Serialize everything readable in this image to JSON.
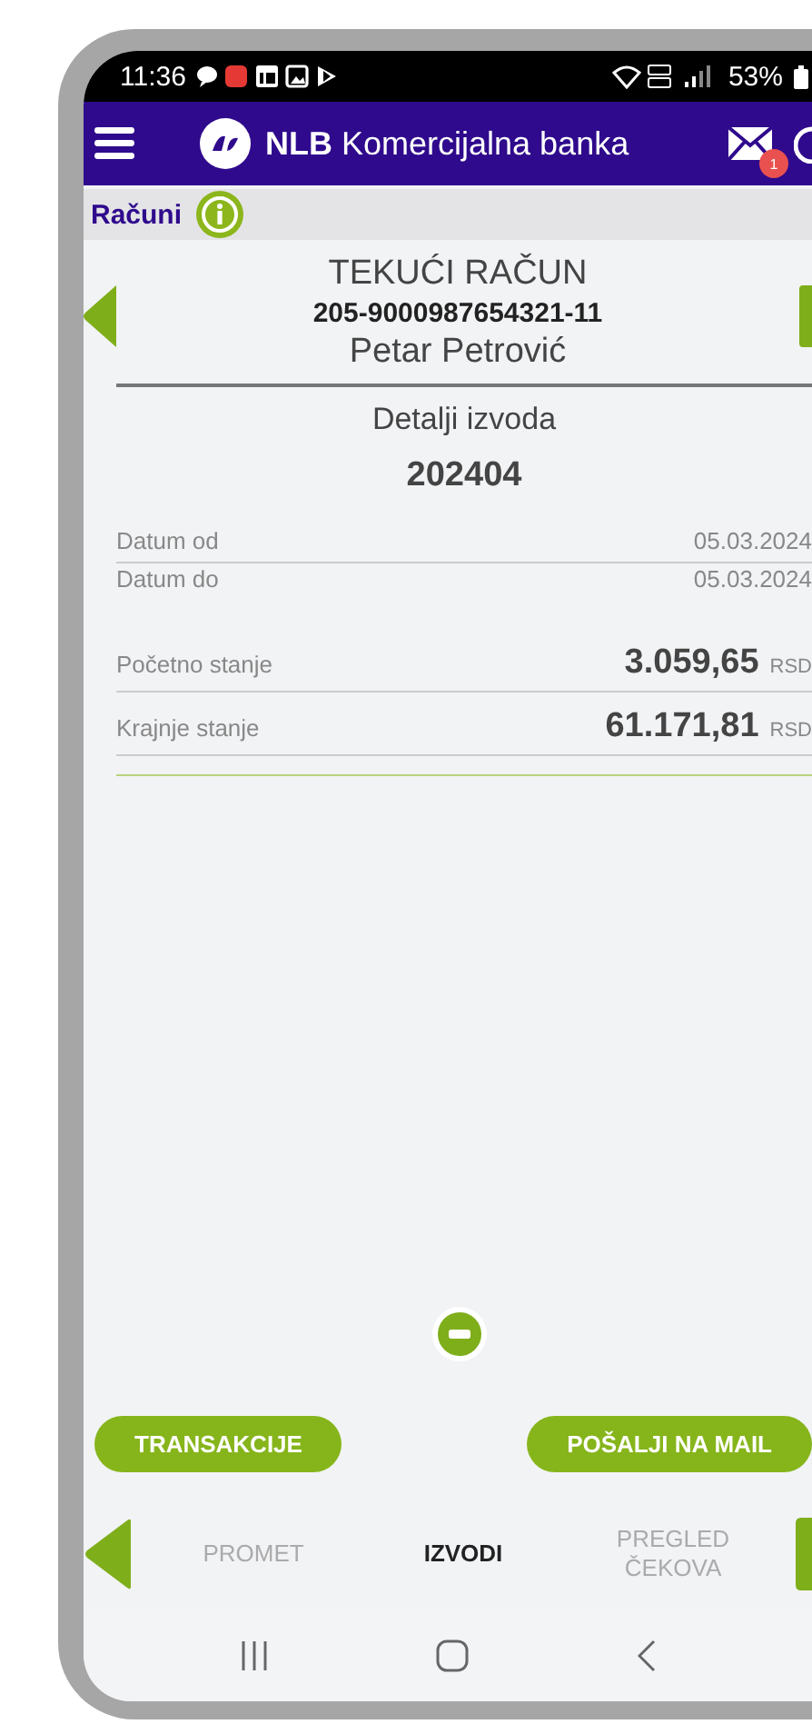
{
  "status_bar": {
    "time": "11:36",
    "battery": "53%"
  },
  "header": {
    "brand": "NLB",
    "title": "Komercijalna banka",
    "mail_badge": "1"
  },
  "section": {
    "title": "Računi"
  },
  "account": {
    "type": "TEKUĆI RAČUN",
    "number": "205-9000987654321-11",
    "owner": "Petar Petrović"
  },
  "statement": {
    "heading": "Detalji izvoda",
    "number": "202404",
    "dates": [
      {
        "label": "Datum od",
        "value": "05.03.2024"
      },
      {
        "label": "Datum do",
        "value": "05.03.2024"
      }
    ],
    "balances": [
      {
        "label": "Početno stanje",
        "amount": "3.059,65",
        "currency": "RSD"
      },
      {
        "label": "Krajnje stanje",
        "amount": "61.171,81",
        "currency": "RSD"
      }
    ]
  },
  "buttons": [
    {
      "label": "TRANSAKCIJE"
    },
    {
      "label": "POŠALJI NA MAIL"
    }
  ],
  "tabs": [
    {
      "label": "PROMET",
      "selected": false
    },
    {
      "label": "IZVODI",
      "selected": true
    },
    {
      "label": "PREGLED ČEKOVA",
      "selected": false
    }
  ]
}
